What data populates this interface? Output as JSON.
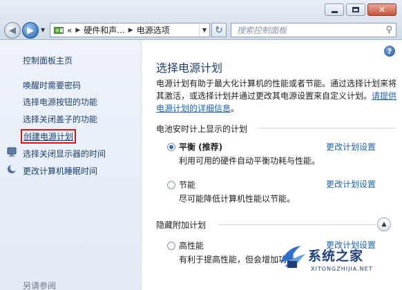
{
  "window": {
    "minimize_label": "",
    "close_label": "✕"
  },
  "nav": {
    "breadcrumb": [
      "«",
      "硬件和声...",
      "电源选项"
    ],
    "search_placeholder": "搜索控制面板"
  },
  "sidebar": {
    "home": "控制面板主页",
    "items": [
      {
        "label": "唤醒时需要密码"
      },
      {
        "label": "选择电源按钮的功能"
      },
      {
        "label": "选择关闭盖子的功能"
      },
      {
        "label": "创建电源计划"
      },
      {
        "label": "选择关闭显示器的时间"
      },
      {
        "label": "更改计算机睡眠时间"
      }
    ],
    "see_also": "另请参阅"
  },
  "main": {
    "title": "选择电源计划",
    "description": "电源计划有助于最大化计算机的性能或者节能。通过选择计划来将其激活，或选择计划并通过更改其电源设置来自定义计划。",
    "description_link": "请提供电源计划的详细信息",
    "description_tail": "。",
    "section_battery": "电池安时计上显示的计划",
    "section_hidden": "隐藏附加计划",
    "plans": [
      {
        "name": "平衡 (推荐)",
        "desc": "利用可用的硬件自动平衡功耗与性能。",
        "change": "更改计划设置",
        "selected": true
      },
      {
        "name": "节能",
        "desc": "尽可能降低计算机性能以节能。",
        "change": "更改计划设置",
        "selected": false
      },
      {
        "name": "高性能",
        "desc": "有利于提高性能，但会增加功耗。",
        "change": "更改计划设置",
        "selected": false
      }
    ]
  },
  "watermark": {
    "brand": "系统之家",
    "site": "XITONGZHIJIA.NET"
  },
  "colors": {
    "link": "#1f61b3",
    "highlight_border": "#e01010",
    "heading": "#1e3f6e"
  }
}
